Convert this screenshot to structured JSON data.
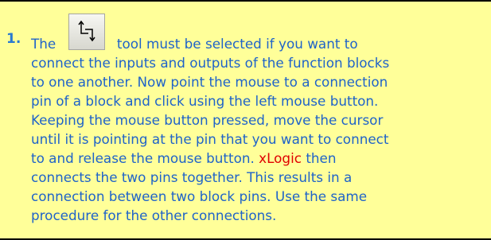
{
  "step": {
    "number": "1.",
    "lines": [
      "connect the inputs and outputs of the function blocks",
      "to one another. Now point the mouse to a connection",
      "pin of a block and click using the left mouse button.",
      "Keeping the mouse button pressed, move the cursor",
      "until it is pointing at the pin that you want to connect"
    ],
    "first_line_before": "The",
    "first_line_after": "tool must be selected if you want to",
    "line7_before": "to and release the mouse button.",
    "brand": "xLogic",
    "line7_after": "then",
    "tail_lines": [
      "connects the two pins together. This results in a",
      "connection between two block pins. Use the same",
      "procedure for the other connections."
    ]
  },
  "tool": {
    "icon": "connect-tool-icon"
  },
  "colors": {
    "background": "#ffff99",
    "text": "#1f63c9",
    "brand": "#e00000",
    "number": "#2a7ad0"
  }
}
